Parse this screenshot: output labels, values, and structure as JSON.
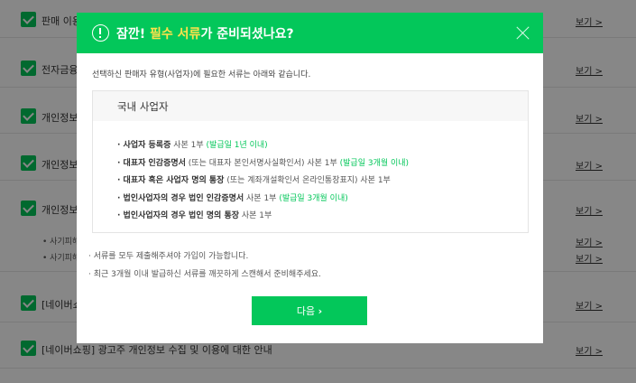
{
  "background": {
    "rows": [
      {
        "label": "판매 이용",
        "link": "보기 >"
      },
      {
        "label": "전자금융",
        "link": "보기 >"
      },
      {
        "label": "개인정보",
        "link": "보기 >"
      },
      {
        "label": "개인정보",
        "link": "보기 >"
      },
      {
        "label": "개인정보",
        "link": "보기 >"
      },
      {
        "label": "[네이버쇼",
        "link": "보기 >"
      },
      {
        "label": "[네이버쇼핑] 광고주 개인정보 수집 및 이용에 대한 안내",
        "link": "보기 >"
      }
    ],
    "sub_items": [
      {
        "label": "• 사기피해",
        "link": "보기 >"
      },
      {
        "label": "• 사기피해",
        "link": "보기 >"
      }
    ]
  },
  "modal": {
    "title_prefix": "잠깐! ",
    "title_highlight": "필수 서류",
    "title_suffix": "가 준비되셨나요?",
    "intro": "선택하신 판매자 유형(사업자)에 필요한 서류는 아래와 같습니다.",
    "box_title": "국내 사업자",
    "docs": [
      {
        "bold": "· 사업자 등록증",
        "normal": " 사본 1부 ",
        "green": "(발급일 1년 이내)"
      },
      {
        "bold": "· 대표자 인감증명서",
        "normal": " (또는 대표자 본인서명사실확인서) 사본 1부 ",
        "green": "(발급일 3개월 이내)"
      },
      {
        "bold": "· 대표자 혹은 사업자 명의 통장",
        "normal": " (또는 계좌개설확인서 온라인통장표지) 사본 1부",
        "green": ""
      },
      {
        "bold": "· 법인사업자의 경우 법인 인감증명서",
        "normal": " 사본 1부 ",
        "green": "(발급일 3개월 이내)"
      },
      {
        "bold": "· 법인사업자의 경우 법인 명의 통장",
        "normal": " 사본 1부",
        "green": ""
      }
    ],
    "notes": [
      "· 서류를 모두 제출해주셔야 가입이 가능합니다.",
      "· 최근 3개월 이내 발급하신 서류를 깨끗하게 스캔해서 준비해주세요."
    ],
    "next_label": "다음",
    "next_arrow": "›",
    "close_icon": "close-icon",
    "alert_icon": "alert-circle-icon"
  },
  "colors": {
    "brand": "#03c75a",
    "title_highlight": "#ffe24b",
    "overlay": "rgba(0,0,0,0.47)"
  }
}
